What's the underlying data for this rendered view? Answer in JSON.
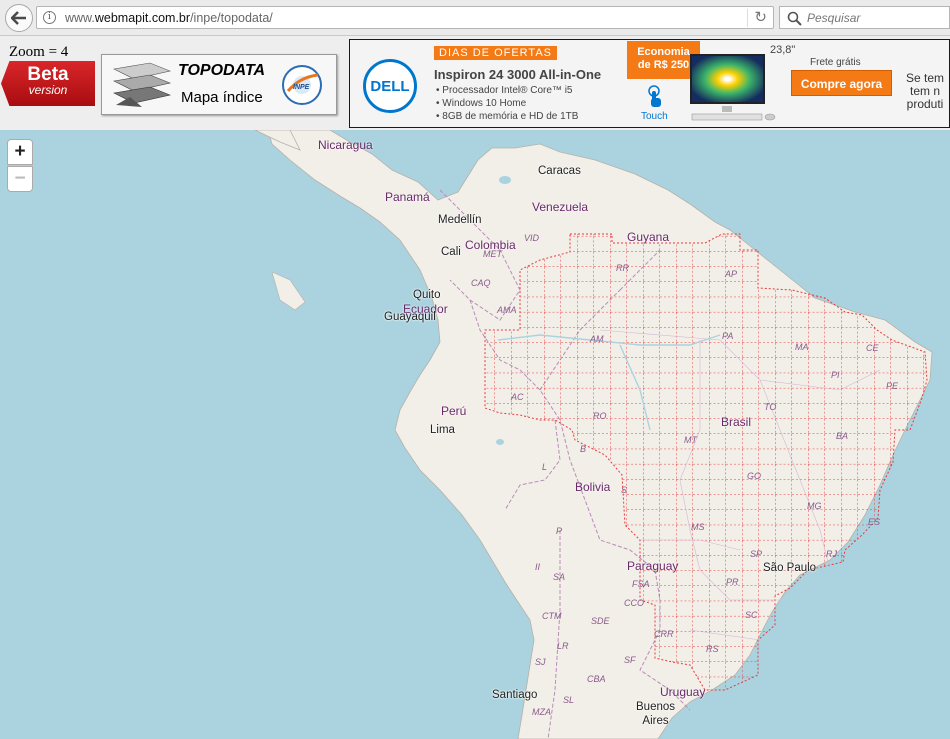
{
  "browser": {
    "url_prefix": "www.",
    "url_domain": "webmapit.com.br",
    "url_path": "/inpe/topodata/",
    "search_placeholder": "Pesquisar"
  },
  "header": {
    "zoom_label": "Zoom = 4",
    "beta_title": "Beta",
    "beta_subtitle": "version",
    "logo_title": "TOPODATA",
    "logo_subtitle": "Mapa índice",
    "inpe_logo": "INPE"
  },
  "ad": {
    "brand": "DELL",
    "offer": "DIAS DE OFERTAS",
    "product": "Inspiron 24 3000 All-in-One",
    "spec1": "• Processador Intel® Core™ i5",
    "spec2": "• Windows 10 Home",
    "spec3": "• 8GB de memória e HD de 1TB",
    "economy": "Economia\nde R$ 250",
    "touch": "Touch",
    "screen_size": "23,8\"",
    "shipping": "Frete grátis",
    "buy_button": "Compre agora",
    "promo": "Se tem\ntem n\nproduti"
  },
  "map": {
    "zoom_in": "+",
    "zoom_out": "−",
    "countries": [
      {
        "name": "Nicaragua"
      },
      {
        "name": "Panamá"
      },
      {
        "name": "Venezuela"
      },
      {
        "name": "Colombia"
      },
      {
        "name": "Guyana"
      },
      {
        "name": "Ecuador"
      },
      {
        "name": "Perú"
      },
      {
        "name": "Brasil"
      },
      {
        "name": "Bolivia"
      },
      {
        "name": "Paraguay"
      },
      {
        "name": "Uruguay"
      }
    ],
    "cities": [
      {
        "name": "Caracas"
      },
      {
        "name": "Medellín"
      },
      {
        "name": "Cali"
      },
      {
        "name": "Quito"
      },
      {
        "name": "Guayaquil"
      },
      {
        "name": "Lima"
      },
      {
        "name": "São Paulo"
      },
      {
        "name": "Santiago"
      },
      {
        "name": "Buenos\nAires"
      }
    ],
    "states": [
      {
        "name": "VID"
      },
      {
        "name": "MET"
      },
      {
        "name": "CAQ"
      },
      {
        "name": "AMA"
      },
      {
        "name": "RR"
      },
      {
        "name": "AP"
      },
      {
        "name": "AM"
      },
      {
        "name": "PA"
      },
      {
        "name": "MA"
      },
      {
        "name": "CE"
      },
      {
        "name": "PI"
      },
      {
        "name": "PE"
      },
      {
        "name": "AC"
      },
      {
        "name": "RO"
      },
      {
        "name": "TO"
      },
      {
        "name": "BA"
      },
      {
        "name": "MT"
      },
      {
        "name": "B"
      },
      {
        "name": "L"
      },
      {
        "name": "GO"
      },
      {
        "name": "MG"
      },
      {
        "name": "S"
      },
      {
        "name": "MS"
      },
      {
        "name": "ES"
      },
      {
        "name": "RJ"
      },
      {
        "name": "SP"
      },
      {
        "name": "P"
      },
      {
        "name": "II"
      },
      {
        "name": "SA"
      },
      {
        "name": "FSA"
      },
      {
        "name": "PR"
      },
      {
        "name": "SC"
      },
      {
        "name": "CTM"
      },
      {
        "name": "CCO"
      },
      {
        "name": "SDE"
      },
      {
        "name": "CRR"
      },
      {
        "name": "RS"
      },
      {
        "name": "LR"
      },
      {
        "name": "SJ"
      },
      {
        "name": "SF"
      },
      {
        "name": "CBA"
      },
      {
        "name": "SL"
      },
      {
        "name": "MZA"
      }
    ]
  }
}
